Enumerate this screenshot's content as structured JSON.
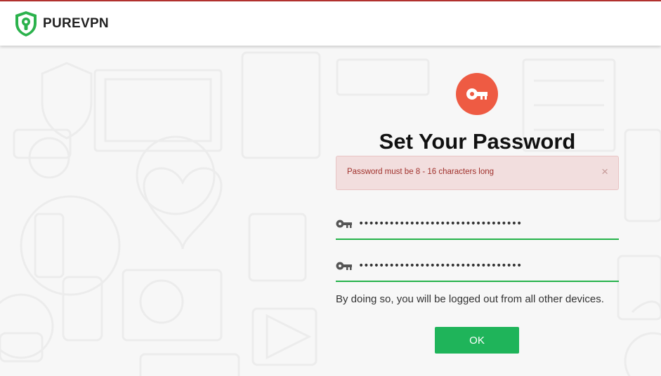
{
  "header": {
    "brand": "PUREVPN",
    "logo_icon": "purevpn-shield-logo",
    "accent_color": "#b3312f"
  },
  "dialog": {
    "icon": "key-icon",
    "icon_color": "#ee5b43",
    "title": "Set Your Password",
    "alert": {
      "message": "Password must be 8 - 16 characters long",
      "close_label": "×",
      "background": "#f2dede"
    },
    "fields": [
      {
        "icon": "key-icon",
        "value": "********************************",
        "type": "password"
      },
      {
        "icon": "key-icon",
        "value": "********************************",
        "type": "password"
      }
    ],
    "note": "By doing so, you will be logged out from all other devices.",
    "ok_label": "OK",
    "ok_color": "#1fb45a"
  }
}
